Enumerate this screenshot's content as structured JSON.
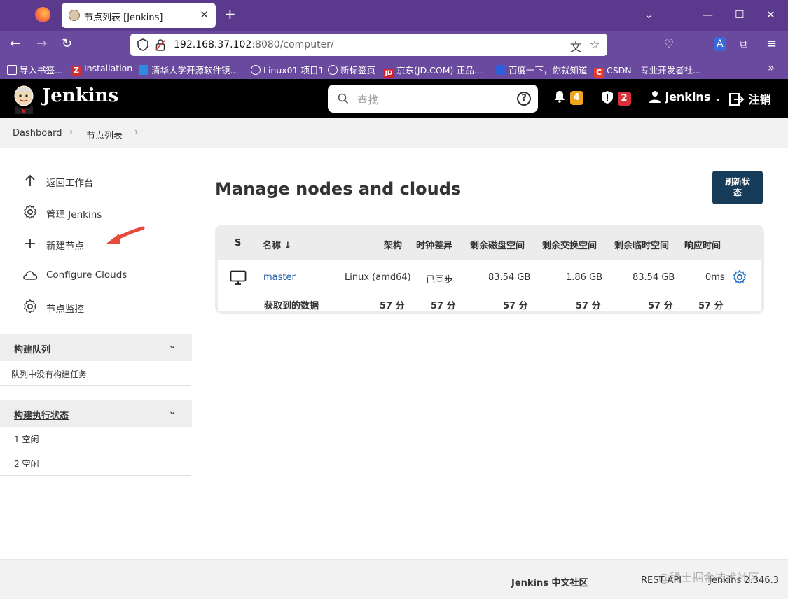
{
  "browser": {
    "tab_title": "节点列表 [Jenkins]",
    "url_host": "192.168.37.102",
    "url_rest": ":8080/computer/",
    "bookmarks": [
      {
        "label": "导入书签...",
        "icon": "import-icon",
        "color": "#ffffff"
      },
      {
        "label": "Installation",
        "icon": "z-icon",
        "color": "#d42b2b"
      },
      {
        "label": "清华大学开源软件镜...",
        "icon": "tuna-icon",
        "color": "#2a8be0"
      },
      {
        "label": "Linux01 项目1",
        "icon": "globe-icon",
        "color": "#ffffff"
      },
      {
        "label": "新标签页",
        "icon": "globe-icon",
        "color": "#ffffff"
      },
      {
        "label": "京东(JD.COM)-正品...",
        "icon": "jd-icon",
        "color": "#d4202a"
      },
      {
        "label": "百度一下，你就知道",
        "icon": "baidu-icon",
        "color": "#2f5fd8"
      },
      {
        "label": "CSDN - 专业开发者社...",
        "icon": "csdn-icon",
        "color": "#e33a2e"
      }
    ]
  },
  "header": {
    "app_name": "Jenkins",
    "search_placeholder": "查找",
    "notifications_count": "4",
    "security_count": "2",
    "user": "jenkins",
    "logout": "注销"
  },
  "breadcrumb": [
    "Dashboard",
    "节点列表"
  ],
  "sidebar": {
    "items": [
      {
        "label": "返回工作台",
        "icon": "arrow-up-icon"
      },
      {
        "label": "管理 Jenkins",
        "icon": "gear-icon"
      },
      {
        "label": "新建节点",
        "icon": "plus-icon"
      },
      {
        "label": "Configure Clouds",
        "icon": "cloud-icon"
      },
      {
        "label": "节点监控",
        "icon": "gear-icon"
      }
    ],
    "build_queue": {
      "title": "构建队列",
      "empty_text": "队列中没有构建任务"
    },
    "executors": {
      "title": "构建执行状态",
      "rows": [
        "1  空闲",
        "2  空闲"
      ]
    }
  },
  "main": {
    "title": "Manage nodes and clouds",
    "refresh_button": "刷新状态",
    "table": {
      "headers": [
        "S",
        "名称 ↓",
        "架构",
        "时钟差异",
        "剩余磁盘空间",
        "剩余交换空间",
        "剩余临时空间",
        "响应时间"
      ],
      "rows": [
        {
          "name": "master",
          "arch": "Linux (amd64)",
          "clock": "已同步",
          "disk": "83.54 GB",
          "swap": "1.86 GB",
          "temp": "83.54 GB",
          "response": "0ms"
        }
      ],
      "footer": {
        "label": "获取到的数据",
        "values": [
          "57 分",
          "57 分",
          "57 分",
          "57 分",
          "57 分",
          "57 分"
        ]
      }
    }
  },
  "footer": {
    "community": "Jenkins 中文社区",
    "rest_api": "REST API",
    "version": "Jenkins 2.346.3"
  },
  "watermark": "@稀土掘金技术社区"
}
